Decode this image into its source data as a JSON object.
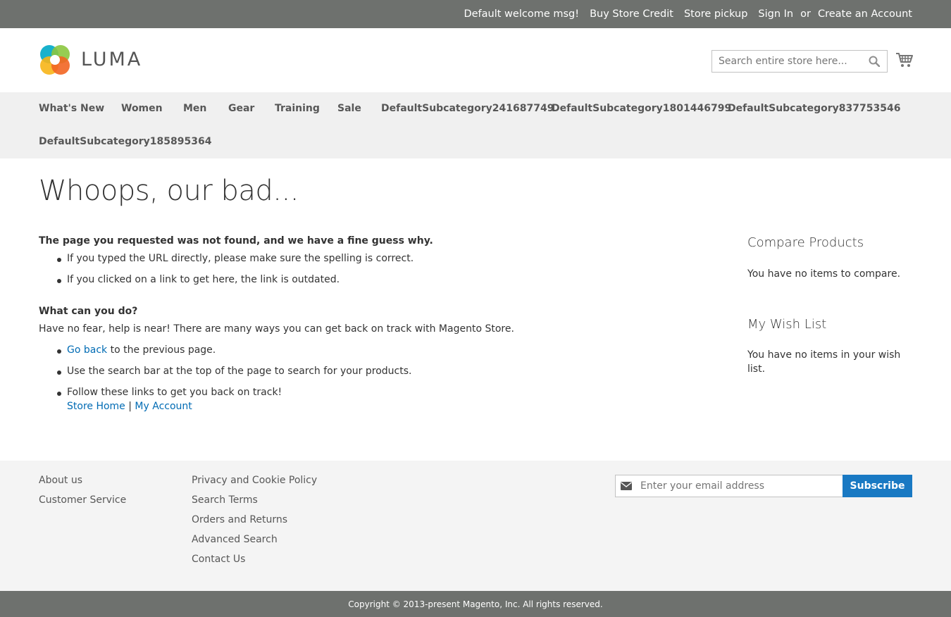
{
  "panel": {
    "welcome": "Default welcome msg!",
    "store_credit": "Buy Store Credit",
    "store_pickup": "Store pickup",
    "sign_in": "Sign In",
    "or": "or",
    "create_account": "Create an Account"
  },
  "header": {
    "logo_text": "LUMA",
    "search_placeholder": "Search entire store here...",
    "icons": {
      "search": "search-icon",
      "cart": "cart-icon"
    }
  },
  "nav": {
    "items": [
      "What's New",
      "Women",
      "Men",
      "Gear",
      "Training",
      "Sale",
      "DefaultSubcategory241687749",
      "DefaultSubcategory1801446799",
      "DefaultSubcategory837753546",
      "DefaultSubcategory185895364"
    ]
  },
  "main": {
    "title": "Whoops, our bad...",
    "not_found_heading": "The page you requested was not found, and we have a fine guess why.",
    "reasons": [
      "If you typed the URL directly, please make sure the spelling is correct.",
      "If you clicked on a link to get here, the link is outdated."
    ],
    "what_heading": "What can you do?",
    "help_text": "Have no fear, help is near! There are many ways you can get back on track with Magento Store.",
    "go_back_link": "Go back",
    "go_back_rest": " to the previous page.",
    "search_tip": "Use the search bar at the top of the page to search for your products.",
    "follow_text": "Follow these links to get you back on track!",
    "store_home": "Store Home",
    "separator": "|",
    "my_account": "My Account"
  },
  "sidebar": {
    "compare_title": "Compare Products",
    "compare_empty": "You have no items to compare.",
    "wishlist_title": "My Wish List",
    "wishlist_empty": "You have no items in your wish list."
  },
  "footer": {
    "col1": [
      "About us",
      "Customer Service"
    ],
    "col2": [
      "Privacy and Cookie Policy",
      "Search Terms",
      "Orders and Returns",
      "Advanced Search",
      "Contact Us"
    ],
    "email_placeholder": "Enter your email address",
    "subscribe_label": "Subscribe",
    "copyright": "Copyright © 2013-present Magento, Inc. All rights reserved."
  },
  "colors": {
    "panel_bg": "#6e716e",
    "nav_bg": "#f0f0f0",
    "footer_bg": "#f4f4f4",
    "link": "#006bb4",
    "primary_button": "#1979c3"
  }
}
